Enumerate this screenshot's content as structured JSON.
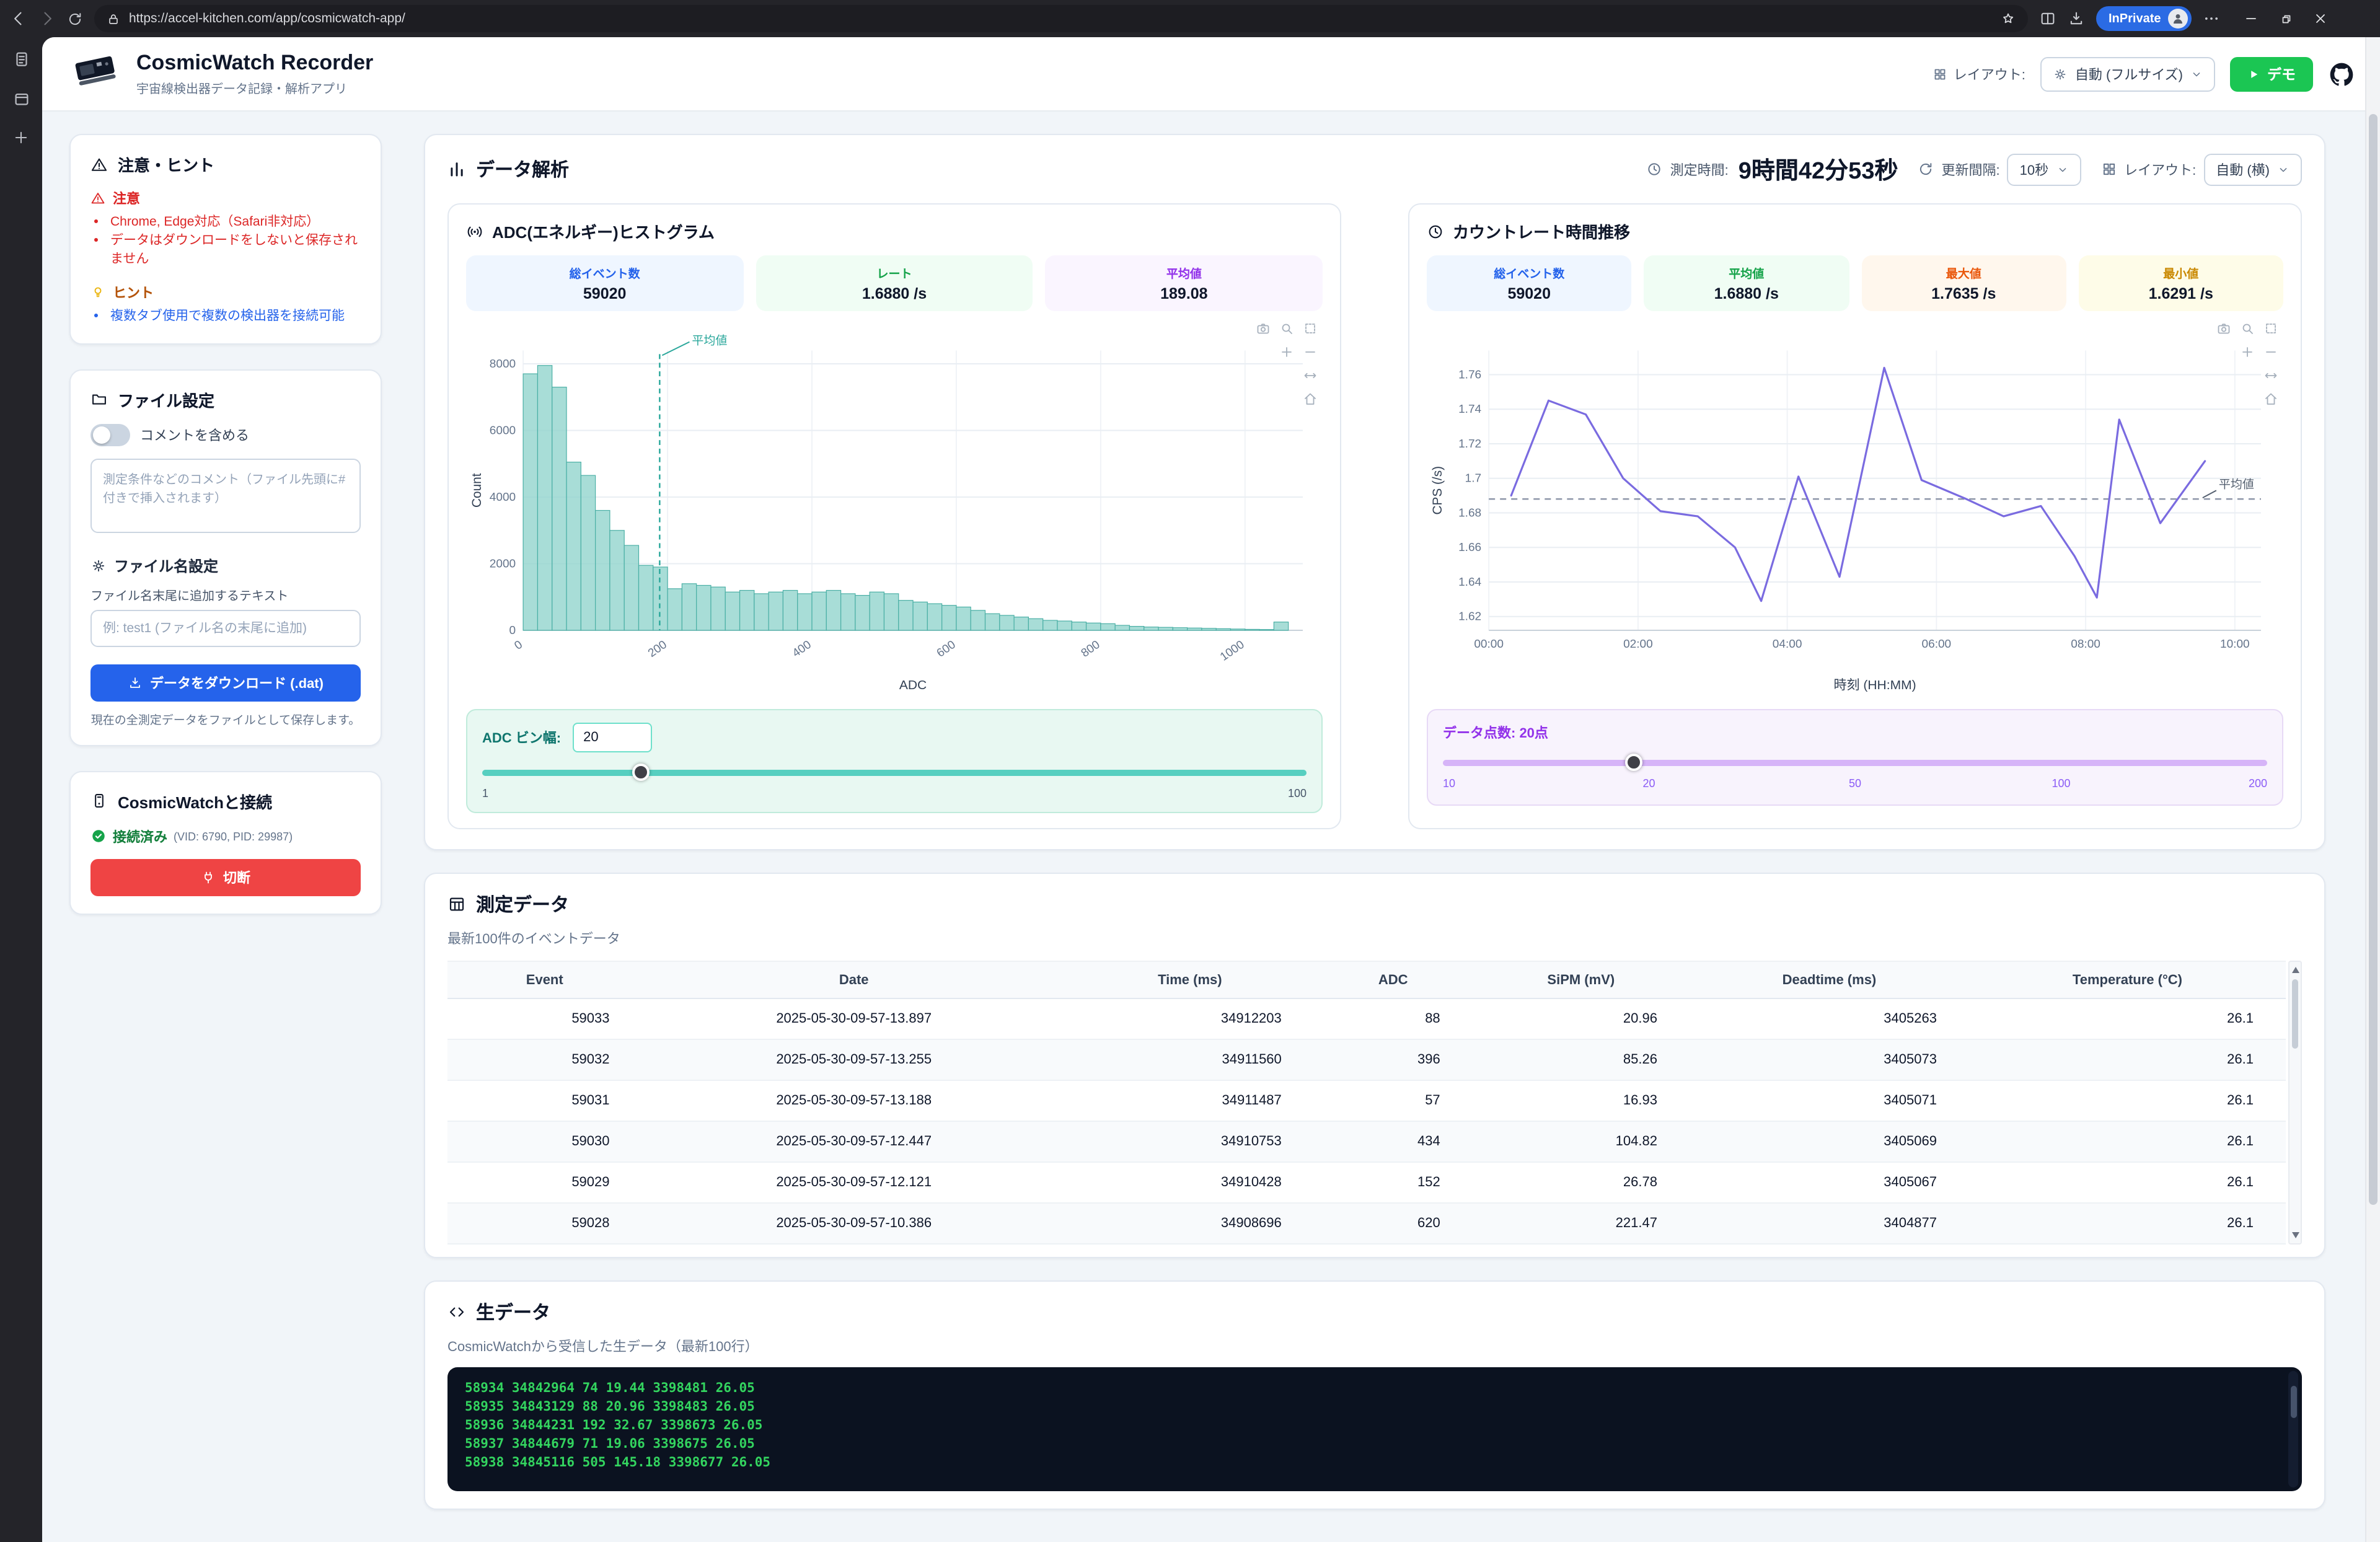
{
  "browser": {
    "url": "https://accel-kitchen.com/app/cosmicwatch-app/",
    "inprivate_label": "InPrivate"
  },
  "app_header": {
    "title": "CosmicWatch Recorder",
    "subtitle": "宇宙線検出器データ記録・解析アプリ",
    "layout_label": "レイアウト:",
    "layout_value": "自動 (フルサイズ)",
    "demo_button": "デモ"
  },
  "sidebar": {
    "notes": {
      "title": "注意・ヒント",
      "warning_title": "注意",
      "warnings": [
        "Chrome, Edge対応（Safari非対応）",
        "データはダウンロードをしないと保存されません"
      ],
      "hint_title": "ヒント",
      "hints": [
        "複数タブ使用で複数の検出器を接続可能"
      ]
    },
    "file_settings": {
      "title": "ファイル設定",
      "comment_toggle_label": "コメントを含める",
      "comment_placeholder": "測定条件などのコメント（ファイル先頭に#付きで挿入されます）",
      "filename_title": "ファイル名設定",
      "filename_label": "ファイル名末尾に追加するテキスト",
      "filename_placeholder": "例: test1 (ファイル名の末尾に追加)",
      "download_button": "データをダウンロード (.dat)",
      "download_caption": "現在の全測定データをファイルとして保存します。"
    },
    "connection": {
      "title": "CosmicWatchと接続",
      "status": "接続済み",
      "status_detail": "(VID: 6790, PID: 29987)",
      "disconnect_button": "切断"
    }
  },
  "analysis": {
    "title": "データ解析",
    "measure_time_label": "測定時間:",
    "measure_time": "9時間42分53秒",
    "interval_label": "更新間隔:",
    "interval_value": "10秒",
    "layout_label": "レイアウト:",
    "layout_value": "自動 (横)"
  },
  "histogram_panel": {
    "title": "ADC(エネルギー)ヒストグラム",
    "stats": [
      {
        "label": "総イベント数",
        "value": "59020",
        "theme": "blue"
      },
      {
        "label": "レート",
        "value": "1.6880 /s",
        "theme": "green"
      },
      {
        "label": "平均値",
        "value": "189.08",
        "theme": "purple"
      }
    ],
    "bin_label": "ADC ビン幅:",
    "bin_value": "20",
    "slider_min": 1,
    "slider_max": 100,
    "slider_value": 20,
    "slider_min_label": "1",
    "slider_max_label": "100"
  },
  "rate_panel": {
    "title": "カウントレート時間推移",
    "stats": [
      {
        "label": "総イベント数",
        "value": "59020",
        "theme": "blue"
      },
      {
        "label": "平均値",
        "value": "1.6880 /s",
        "theme": "green"
      },
      {
        "label": "最大値",
        "value": "1.7635 /s",
        "theme": "orange"
      },
      {
        "label": "最小値",
        "value": "1.6291 /s",
        "theme": "yellow"
      }
    ],
    "points_label": "データ点数: 20点",
    "slider_ticks": [
      "10",
      "20",
      "50",
      "100",
      "200"
    ],
    "slider_min": 10,
    "slider_max": 200,
    "slider_value": 20
  },
  "chart_data": [
    {
      "type": "bar",
      "title": "ADC(エネルギー)ヒストグラム",
      "xlabel": "ADC",
      "ylabel": "Count",
      "bin_start": 0,
      "bin_width": 20,
      "counts": [
        7700,
        7950,
        7300,
        5050,
        4650,
        3600,
        3000,
        2550,
        1950,
        1900,
        1250,
        1400,
        1350,
        1300,
        1150,
        1200,
        1100,
        1150,
        1200,
        1100,
        1150,
        1200,
        1100,
        1050,
        1150,
        1100,
        900,
        850,
        800,
        750,
        700,
        600,
        500,
        450,
        400,
        350,
        300,
        280,
        250,
        220,
        200,
        150,
        120,
        100,
        90,
        80,
        70,
        60,
        50,
        40,
        30,
        25,
        250
      ],
      "mean": 189.08,
      "mean_annotation": "平均値",
      "xlim": [
        0,
        1080
      ],
      "ylim": [
        0,
        8400
      ],
      "x_ticks": [
        0,
        200,
        400,
        600,
        800,
        1000
      ],
      "y_ticks": [
        0,
        2000,
        4000,
        6000,
        8000
      ],
      "bar_color": "#8fd3cc",
      "bar_line_color": "#4cb0a6",
      "mean_color": "#2aa79b"
    },
    {
      "type": "line",
      "title": "カウントレート時間推移",
      "xlabel": "時刻 (HH:MM)",
      "ylabel": "CPS (/s)",
      "x_hours": [
        0.3,
        0.8,
        1.3,
        1.8,
        2.3,
        2.8,
        3.3,
        3.65,
        4.15,
        4.7,
        5.3,
        5.8,
        6.4,
        6.9,
        7.4,
        7.85,
        8.15,
        8.45,
        9.0,
        9.6
      ],
      "cps": [
        1.69,
        1.745,
        1.737,
        1.7,
        1.681,
        1.678,
        1.66,
        1.629,
        1.701,
        1.643,
        1.764,
        1.699,
        1.688,
        1.678,
        1.684,
        1.655,
        1.631,
        1.734,
        1.674,
        1.71
      ],
      "mean": 1.688,
      "mean_annotation": "平均値",
      "xlim": [
        0,
        10.35
      ],
      "ylim": [
        1.612,
        1.774
      ],
      "x_ticks": [
        0,
        2,
        4,
        6,
        8,
        10
      ],
      "x_tick_labels": [
        "00:00",
        "02:00",
        "04:00",
        "06:00",
        "08:00",
        "10:00"
      ],
      "y_ticks": [
        1.62,
        1.64,
        1.66,
        1.68,
        1.7,
        1.72,
        1.74,
        1.76
      ],
      "y_tick_labels": [
        "1.62",
        "1.64",
        "1.66",
        "1.68",
        "1.7",
        "1.72",
        "1.74",
        "1.76"
      ],
      "line_color": "#7a6be0",
      "mean_color": "#8a93a6"
    }
  ],
  "table_section": {
    "title": "測定データ",
    "caption": "最新100件のイベントデータ",
    "headers": [
      "Event",
      "Date",
      "Time (ms)",
      "ADC",
      "SiPM (mV)",
      "Deadtime (ms)",
      "Temperature (°C)"
    ],
    "rows": [
      [
        "59033",
        "2025-05-30-09-57-13.897",
        "34912203",
        "88",
        "20.96",
        "3405263",
        "26.1"
      ],
      [
        "59032",
        "2025-05-30-09-57-13.255",
        "34911560",
        "396",
        "85.26",
        "3405073",
        "26.1"
      ],
      [
        "59031",
        "2025-05-30-09-57-13.188",
        "34911487",
        "57",
        "16.93",
        "3405071",
        "26.1"
      ],
      [
        "59030",
        "2025-05-30-09-57-12.447",
        "34910753",
        "434",
        "104.82",
        "3405069",
        "26.1"
      ],
      [
        "59029",
        "2025-05-30-09-57-12.121",
        "34910428",
        "152",
        "26.78",
        "3405067",
        "26.1"
      ],
      [
        "59028",
        "2025-05-30-09-57-10.386",
        "34908696",
        "620",
        "221.47",
        "3404877",
        "26.1"
      ]
    ]
  },
  "raw_section": {
    "title": "生データ",
    "caption": "CosmicWatchから受信した生データ（最新100行）",
    "lines": [
      "58934 34842964 74 19.44 3398481 26.05",
      "58935 34843129 88 20.96 3398483 26.05",
      "58936 34844231 192 32.67 3398673 26.05",
      "58937 34844679 71 19.06 3398675 26.05",
      "58938 34845116 505 145.18 3398677 26.05"
    ]
  }
}
